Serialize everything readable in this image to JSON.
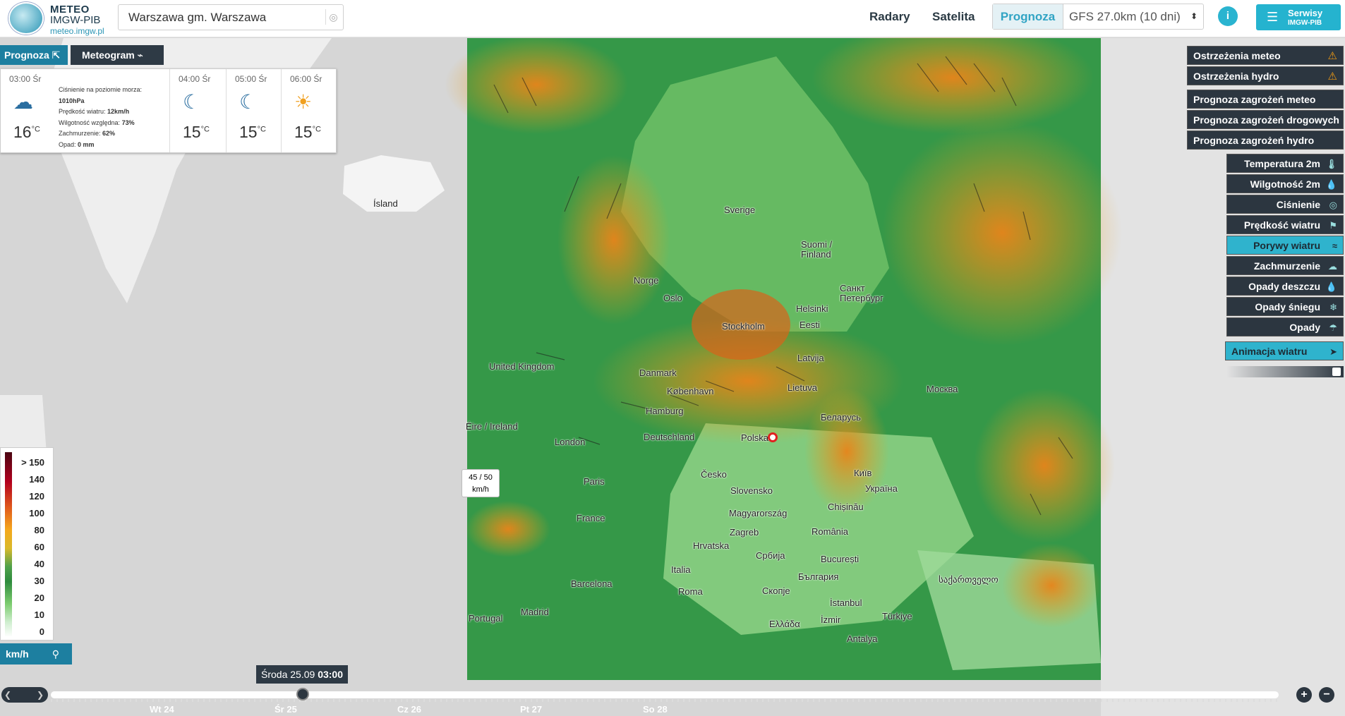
{
  "header": {
    "logo_title": "METEO",
    "logo_sub": "IMGW-PIB",
    "logo_url": "meteo.imgw.pl",
    "search_value": "Warszawa gm. Warszawa",
    "nav_radary": "Radary",
    "nav_satelita": "Satelita",
    "mode_active": "Prognoza",
    "model_select": "GFS 27.0km (10 dni)",
    "services_title": "Serwisy",
    "services_sub": "IMGW-PIB"
  },
  "forecast": {
    "tab_prognoza": "Prognoza",
    "tab_meteogram": "Meteogram",
    "slots": [
      {
        "time": "03:00 Śr",
        "icon": "partly-cloudy-icon",
        "temp": "16"
      },
      {
        "time": "04:00 Śr",
        "icon": "moon-icon",
        "temp": "15"
      },
      {
        "time": "05:00 Śr",
        "icon": "moon-icon",
        "temp": "15"
      },
      {
        "time": "06:00 Śr",
        "icon": "sun-icon",
        "temp": "15"
      }
    ],
    "unit": "°C",
    "details": {
      "pressure_label": "Ciśnienie na poziomie morza:",
      "pressure_value": "1010hPa",
      "wind_label": "Prędkość wiatru:",
      "wind_value": "12km/h",
      "humidity_label": "Wilgotność względna:",
      "humidity_value": "73%",
      "cloud_label": "Zachmurzenie:",
      "cloud_value": "62%",
      "precip_label": "Opad:",
      "precip_value": "0 mm"
    }
  },
  "right_menu": {
    "warnings": [
      "Ostrzeżenia meteo",
      "Ostrzeżenia hydro"
    ],
    "threats": [
      "Prognoza zagrożeń meteo",
      "Prognoza zagrożeń drogowych",
      "Prognoza zagrożeń hydro"
    ],
    "layers": [
      {
        "label": "Temperatura 2m",
        "icon": "thermometer-icon"
      },
      {
        "label": "Wilgotność 2m",
        "icon": "droplet-icon"
      },
      {
        "label": "Ciśnienie",
        "icon": "gauge-icon"
      },
      {
        "label": "Prędkość wiatru",
        "icon": "windsock-icon"
      },
      {
        "label": "Porywy wiatru",
        "icon": "wind-icon",
        "active": true
      },
      {
        "label": "Zachmurzenie",
        "icon": "cloud-icon"
      },
      {
        "label": "Opady deszczu",
        "icon": "raindrop-icon"
      },
      {
        "label": "Opady śniegu",
        "icon": "snowflake-icon"
      },
      {
        "label": "Opady",
        "icon": "rain-cloud-icon"
      }
    ],
    "animation": "Animacja wiatru"
  },
  "legend": {
    "values": [
      "> 150",
      "140",
      "120",
      "100",
      "80",
      "60",
      "40",
      "30",
      "20",
      "10",
      "0"
    ],
    "unit": "km/h"
  },
  "tooltip": {
    "value": "45 / 50",
    "unit": "km/h"
  },
  "timeline": {
    "current_day": "Środa 25.09",
    "current_time": "03:00",
    "days": [
      "Wt 24",
      "Śr 25",
      "Cz 26",
      "Pt 27",
      "So 28"
    ]
  },
  "map_labels": [
    "Ísland",
    "Sverige",
    "Suomi / Finland",
    "Norge",
    "Oslo",
    "Stockholm",
    "Helsinki",
    "Санкт Петербург",
    "Eesti",
    "Latvija",
    "United Kingdom",
    "Danmark",
    "København",
    "Lietuva",
    "Москва",
    "Éire / Ireland",
    "Hamburg",
    "Беларусь",
    "London",
    "Deutschland",
    "Polska",
    "Paris",
    "Česko",
    "Київ",
    "Україна",
    "Slovensko",
    "France",
    "Magyarország",
    "Chișinău",
    "Zagreb",
    "România",
    "Hrvatska",
    "Србија",
    "București",
    "Italia",
    "България",
    "Barcelona",
    "Roma",
    "Скопје",
    "İstanbul",
    "Portugal",
    "Madrid",
    "İzmir",
    "Türkiye",
    "Ελλάδα",
    "Antalya",
    "საქართველო"
  ],
  "colors": {
    "accent": "#2ab4d0",
    "dark": "#2c3640",
    "active_tab": "#1d7fa0"
  }
}
